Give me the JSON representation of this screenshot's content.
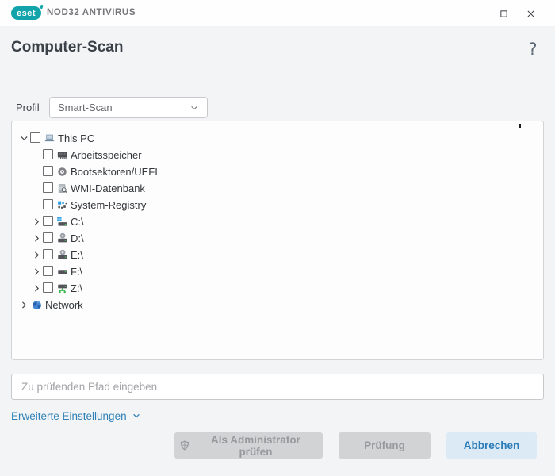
{
  "window": {
    "brand": "eset",
    "product": "NOD32 ANTIVIRUS"
  },
  "header": {
    "title": "Computer-Scan",
    "help": "?"
  },
  "profile": {
    "label": "Profil",
    "value": "Smart-Scan"
  },
  "tree": {
    "items": [
      {
        "label": "This PC",
        "icon": "computer-icon",
        "level": 0,
        "chevron": "expanded",
        "checkbox": true,
        "checked": false
      },
      {
        "label": "Arbeitsspeicher",
        "icon": "memory-icon",
        "level": 1,
        "chevron": "none",
        "checkbox": true,
        "checked": false
      },
      {
        "label": "Bootsektoren/UEFI",
        "icon": "bootsector-icon",
        "level": 1,
        "chevron": "none",
        "checkbox": true,
        "checked": false
      },
      {
        "label": "WMI-Datenbank",
        "icon": "wmi-database-icon",
        "level": 1,
        "chevron": "none",
        "checkbox": true,
        "checked": false
      },
      {
        "label": "System-Registry",
        "icon": "registry-icon",
        "level": 1,
        "chevron": "none",
        "checkbox": true,
        "checked": false
      },
      {
        "label": "C:\\",
        "icon": "drive-windows-icon",
        "level": 1,
        "chevron": "collapsed",
        "checkbox": true,
        "checked": false
      },
      {
        "label": "D:\\",
        "icon": "drive-optical-icon",
        "level": 1,
        "chevron": "collapsed",
        "checkbox": true,
        "checked": false
      },
      {
        "label": "E:\\",
        "icon": "drive-optical-icon",
        "level": 1,
        "chevron": "collapsed",
        "checkbox": true,
        "checked": false
      },
      {
        "label": "F:\\",
        "icon": "drive-icon",
        "level": 1,
        "chevron": "collapsed",
        "checkbox": true,
        "checked": false
      },
      {
        "label": "Z:\\",
        "icon": "drive-network-icon",
        "level": 1,
        "chevron": "collapsed",
        "checkbox": true,
        "checked": false
      },
      {
        "label": "Network",
        "icon": "network-globe-icon",
        "level": 0,
        "chevron": "collapsed",
        "checkbox": false,
        "checked": false
      }
    ]
  },
  "path_input": {
    "value": "",
    "placeholder": "Zu prüfenden Pfad eingeben"
  },
  "advanced": {
    "label": "Erweiterte Einstellungen"
  },
  "buttons": {
    "scan_admin": {
      "label": "Als Administrator prüfen",
      "enabled": false
    },
    "scan": {
      "label": "Prüfung",
      "enabled": false
    },
    "cancel": {
      "label": "Abbrechen",
      "enabled": true
    }
  },
  "colors": {
    "brand_teal": "#13a4ab",
    "link_blue": "#2e80b6",
    "cancel_bg": "#dbeaf5",
    "cancel_text": "#2b7dba",
    "disabled_bg": "#d2d3d5",
    "disabled_text": "#97999c",
    "background": "#f3f4f6",
    "titlebar_bg": "#fefefe",
    "heading_text": "#3b4149"
  }
}
